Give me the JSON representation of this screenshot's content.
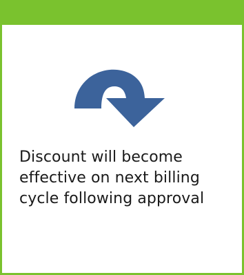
{
  "card": {
    "icon": "curved-turn-arrow-icon",
    "message": "Discount will become effective on next billing cycle following approval"
  },
  "colors": {
    "accent": "#7ac22e",
    "icon": "#3c639b",
    "text": "#1a1a1a",
    "background": "#ffffff"
  }
}
